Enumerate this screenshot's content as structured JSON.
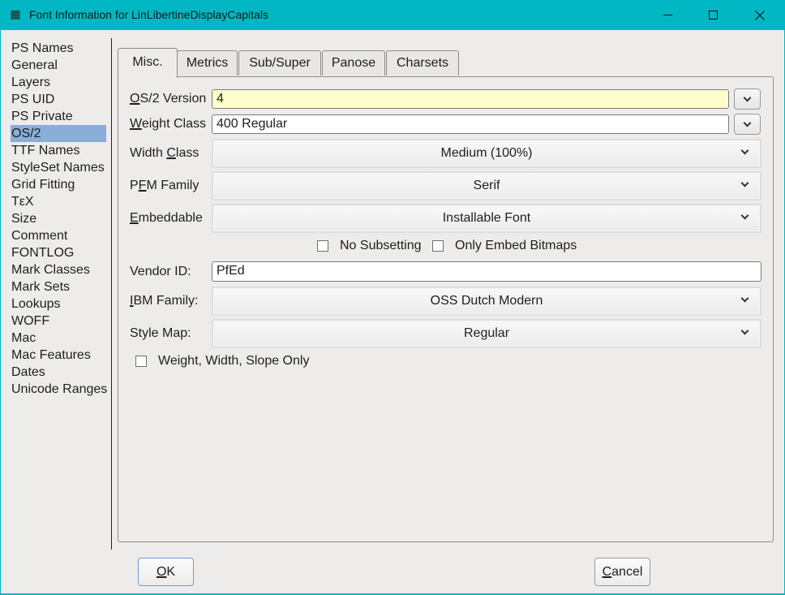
{
  "window": {
    "title": "Font Information for LinLibertineDisplayCapitals",
    "app_icon": "fontforge-icon",
    "controls": {
      "minimize": "minimize",
      "maximize": "maximize",
      "close": "close"
    }
  },
  "sidebar": {
    "selected": "OS/2",
    "items": [
      {
        "label": "PS Names"
      },
      {
        "label": "General"
      },
      {
        "label": "Layers"
      },
      {
        "label": "PS UID"
      },
      {
        "label": "PS Private"
      },
      {
        "label": "OS/2"
      },
      {
        "label": "TTF Names"
      },
      {
        "label": "StyleSet Names"
      },
      {
        "label": "Grid Fitting"
      },
      {
        "label": "TεX"
      },
      {
        "label": "Size"
      },
      {
        "label": "Comment"
      },
      {
        "label": "FONTLOG"
      },
      {
        "label": "Mark Classes"
      },
      {
        "label": "Mark Sets"
      },
      {
        "label": "Lookups"
      },
      {
        "label": "WOFF"
      },
      {
        "label": "Mac"
      },
      {
        "label": "Mac Features"
      },
      {
        "label": "Dates"
      },
      {
        "label": "Unicode Ranges"
      }
    ]
  },
  "tabs": {
    "active": "Misc.",
    "items": [
      {
        "label": "Misc."
      },
      {
        "label": "Metrics"
      },
      {
        "label": "Sub/Super"
      },
      {
        "label": "Panose"
      },
      {
        "label": "Charsets"
      }
    ]
  },
  "form": {
    "os2_version": {
      "label_mnemonic": "O",
      "label_rest": "S/2 Version",
      "value": "4"
    },
    "weight_class": {
      "label_mnemonic": "W",
      "label_rest": "eight Class",
      "value": "400 Regular"
    },
    "width_class": {
      "label_pre": "Width ",
      "label_mnemonic": "C",
      "label_rest": "lass",
      "value": "Medium (100%)"
    },
    "pfm_family": {
      "label_pre": "P",
      "label_mnemonic": "F",
      "label_rest": "M Family",
      "value": "Serif"
    },
    "embeddable": {
      "label_mnemonic": "E",
      "label_rest": "mbeddable",
      "value": "Installable Font"
    },
    "no_subsetting": {
      "label": "No Subsetting",
      "checked": false
    },
    "only_embed_bitmaps": {
      "label": "Only Embed Bitmaps",
      "checked": false
    },
    "vendor_id": {
      "label": "Vendor ID:",
      "value": "PfEd"
    },
    "ibm_family": {
      "label_mnemonic": "I",
      "label_rest": "BM Family:",
      "value": "OSS Dutch Modern"
    },
    "style_map": {
      "label": "Style Map:",
      "value": "Regular"
    },
    "wws_only": {
      "label": "Weight, Width, Slope Only",
      "checked": false
    }
  },
  "buttons": {
    "ok": {
      "mnemonic": "O",
      "rest": "K"
    },
    "cancel": {
      "mnemonic": "C",
      "rest": "ancel"
    }
  },
  "colors": {
    "titlebar": "#00b7c3",
    "selection": "#8aaed8",
    "highlight_field": "#fefdcc",
    "background": "#edecea"
  }
}
